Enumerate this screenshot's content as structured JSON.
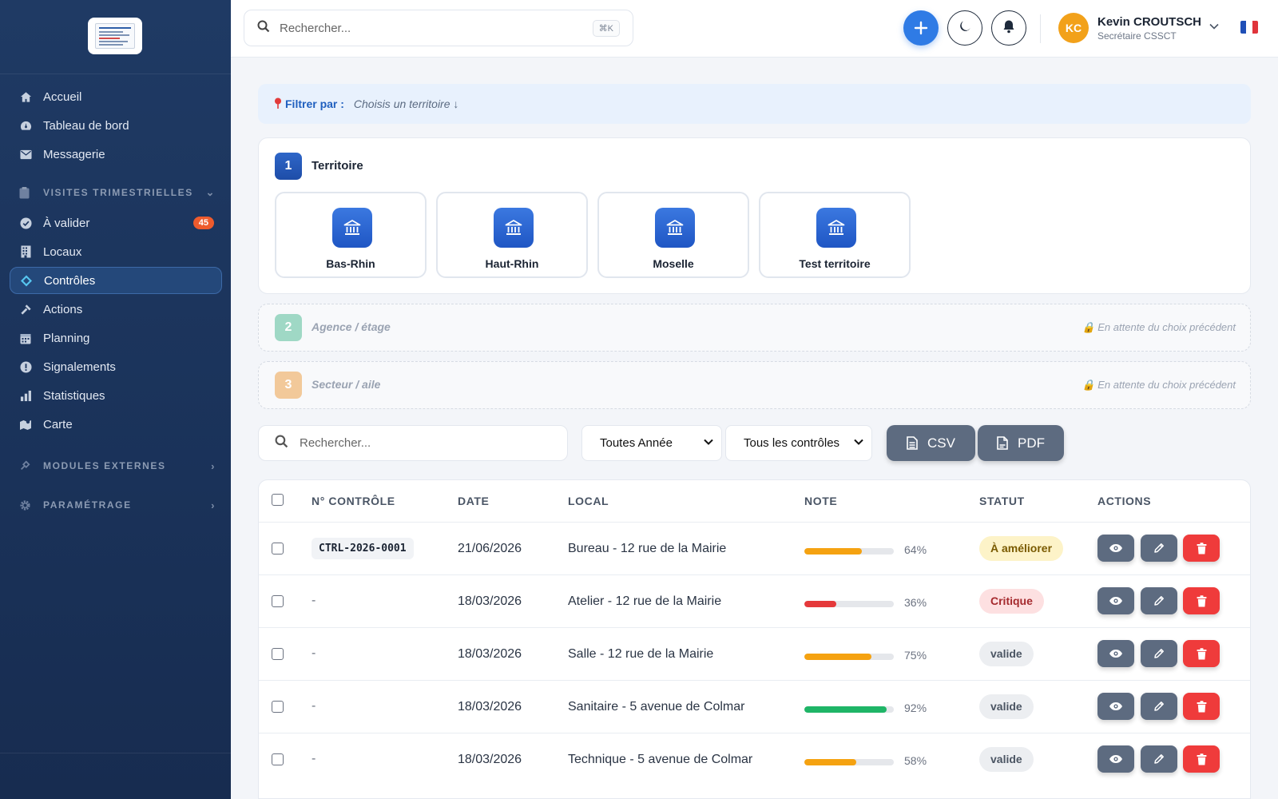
{
  "sidebar": {
    "items": [
      {
        "label": "Accueil",
        "icon": "home-icon"
      },
      {
        "label": "Tableau de bord",
        "icon": "dashboard-icon"
      },
      {
        "label": "Messagerie",
        "icon": "mail-icon"
      }
    ],
    "section_visites": "VISITES TRIMESTRIELLES",
    "visites_items": [
      {
        "label": "À valider",
        "icon": "check-circle-icon",
        "badge": "45"
      },
      {
        "label": "Locaux",
        "icon": "building-icon"
      },
      {
        "label": "Contrôles",
        "icon": "diamond-icon",
        "active": true
      },
      {
        "label": "Actions",
        "icon": "hammer-icon"
      },
      {
        "label": "Planning",
        "icon": "calendar-icon"
      },
      {
        "label": "Signalements",
        "icon": "alert-icon"
      },
      {
        "label": "Statistiques",
        "icon": "bar-chart-icon"
      },
      {
        "label": "Carte",
        "icon": "map-icon"
      }
    ],
    "section_modules": "MODULES EXTERNES",
    "section_parametrage": "PARAMÉTRAGE"
  },
  "header": {
    "search_placeholder": "Rechercher...",
    "shortcut": "⌘K",
    "user_initials": "KC",
    "user_name": "Kevin CROUTSCH",
    "user_role": "Secrétaire CSSCT"
  },
  "filter": {
    "label": "Filtrer par :",
    "hint": "Choisis un territoire ↓"
  },
  "steps": {
    "step1": {
      "num": "1",
      "title": "Territoire"
    },
    "step2": {
      "num": "2",
      "title": "Agence / étage",
      "wait": "En attente du choix précédent"
    },
    "step3": {
      "num": "3",
      "title": "Secteur / aile",
      "wait": "En attente du choix précédent"
    }
  },
  "territoires": [
    "Bas-Rhin",
    "Haut-Rhin",
    "Moselle",
    "Test territoire"
  ],
  "toolbar": {
    "search_placeholder": "Rechercher...",
    "year_select": "Toutes Année",
    "type_select": "Tous les contrôles",
    "csv_label": "CSV",
    "pdf_label": "PDF"
  },
  "table": {
    "headers": {
      "num": "N° CONTRÔLE",
      "date": "DATE",
      "local": "LOCAL",
      "note": "NOTE",
      "statut": "STATUT",
      "actions": "ACTIONS"
    },
    "rows": [
      {
        "num": "CTRL-2026-0001",
        "date": "21/06/2026",
        "local": "Bureau - 12 rue de la Mairie",
        "note": 64,
        "note_label": "64%",
        "statut": "À améliorer",
        "statut_kind": "warn"
      },
      {
        "num": "-",
        "date": "18/03/2026",
        "local": "Atelier - 12 rue de la Mairie",
        "note": 36,
        "note_label": "36%",
        "statut": "Critique",
        "statut_kind": "crit"
      },
      {
        "num": "-",
        "date": "18/03/2026",
        "local": "Salle - 12 rue de la Mairie",
        "note": 75,
        "note_label": "75%",
        "statut": "valide",
        "statut_kind": "ok"
      },
      {
        "num": "-",
        "date": "18/03/2026",
        "local": "Sanitaire - 5 avenue de Colmar",
        "note": 92,
        "note_label": "92%",
        "statut": "valide",
        "statut_kind": "ok"
      },
      {
        "num": "-",
        "date": "18/03/2026",
        "local": "Technique - 5 avenue de Colmar",
        "note": 58,
        "note_label": "58%",
        "statut": "valide",
        "statut_kind": "ok"
      }
    ]
  },
  "colors": {
    "accent": "#2f7be5",
    "bar_orange": "#f5a211",
    "bar_red": "#e5393b",
    "bar_green": "#1fb567",
    "badge_warn_bg": "#fdf3c8",
    "badge_crit_bg": "#fde0e1",
    "badge_ok_bg": "#eceef1"
  }
}
